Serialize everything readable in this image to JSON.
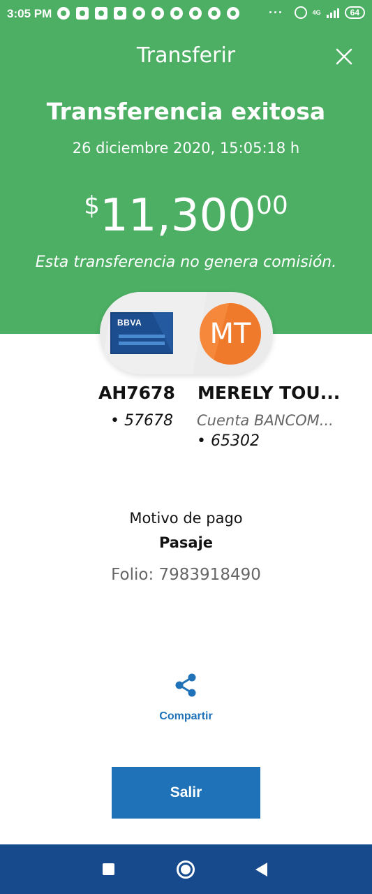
{
  "status_bar": {
    "time": "3:05 PM",
    "dots": "···",
    "network": "4G",
    "battery": "64"
  },
  "header": {
    "title": "Transferir"
  },
  "result": {
    "title": "Transferencia exitosa",
    "date": "26 diciembre 2020, 15:05:18 h",
    "amount_symbol": "$",
    "amount_main": "11,300",
    "amount_cents": "00",
    "commission_note": "Esta transferencia no genera comisión."
  },
  "origin": {
    "card_brand": "BBVA",
    "name": "AH7678",
    "digits": "• 57678"
  },
  "destination": {
    "initials": "MT",
    "name": "MERELY TOU...",
    "bank": "Cuenta BANCOM...",
    "digits": "• 65302"
  },
  "concept": {
    "label": "Motivo de pago",
    "value": "Pasaje",
    "folio": "Folio: 7983918490"
  },
  "actions": {
    "share_label": "Compartir",
    "exit_label": "Salir"
  },
  "colors": {
    "header_green": "#4caf63",
    "accent_blue": "#1f72b8",
    "nav_blue": "#174a8c",
    "avatar_orange": "#f5883a"
  },
  "icons": {
    "close": "close-icon",
    "share": "share-icon",
    "alarm": "alarm-icon",
    "signal": "signal-icon"
  }
}
